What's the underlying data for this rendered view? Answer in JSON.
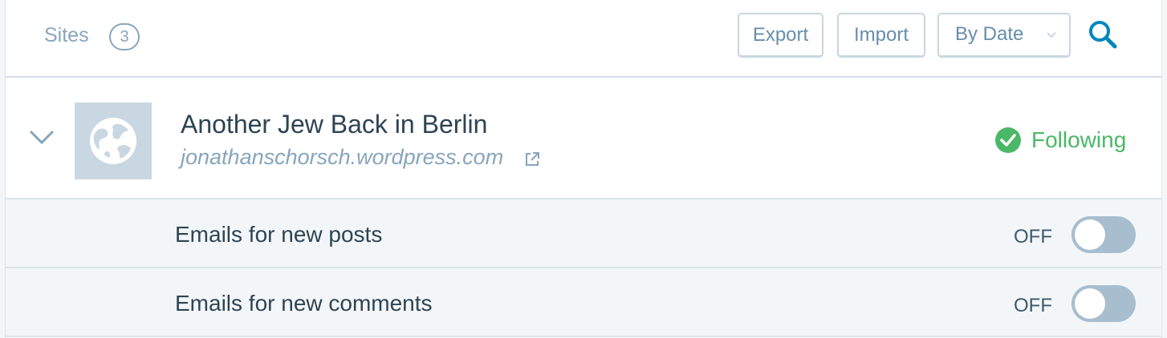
{
  "header": {
    "sites_label": "Sites",
    "sites_count": "3",
    "export_label": "Export",
    "import_label": "Import",
    "sort_label": "By Date"
  },
  "site": {
    "title": "Another Jew Back in Berlin",
    "url": "jonathanschorsch.wordpress.com",
    "follow_status": "Following"
  },
  "settings": [
    {
      "label": "Emails for new posts",
      "state": "OFF"
    },
    {
      "label": "Emails for new comments",
      "state": "OFF"
    }
  ],
  "colors": {
    "accent": "#0087be",
    "following": "#4ab866",
    "muted": "#87a6bc",
    "toggle_off": "#a8bece"
  }
}
